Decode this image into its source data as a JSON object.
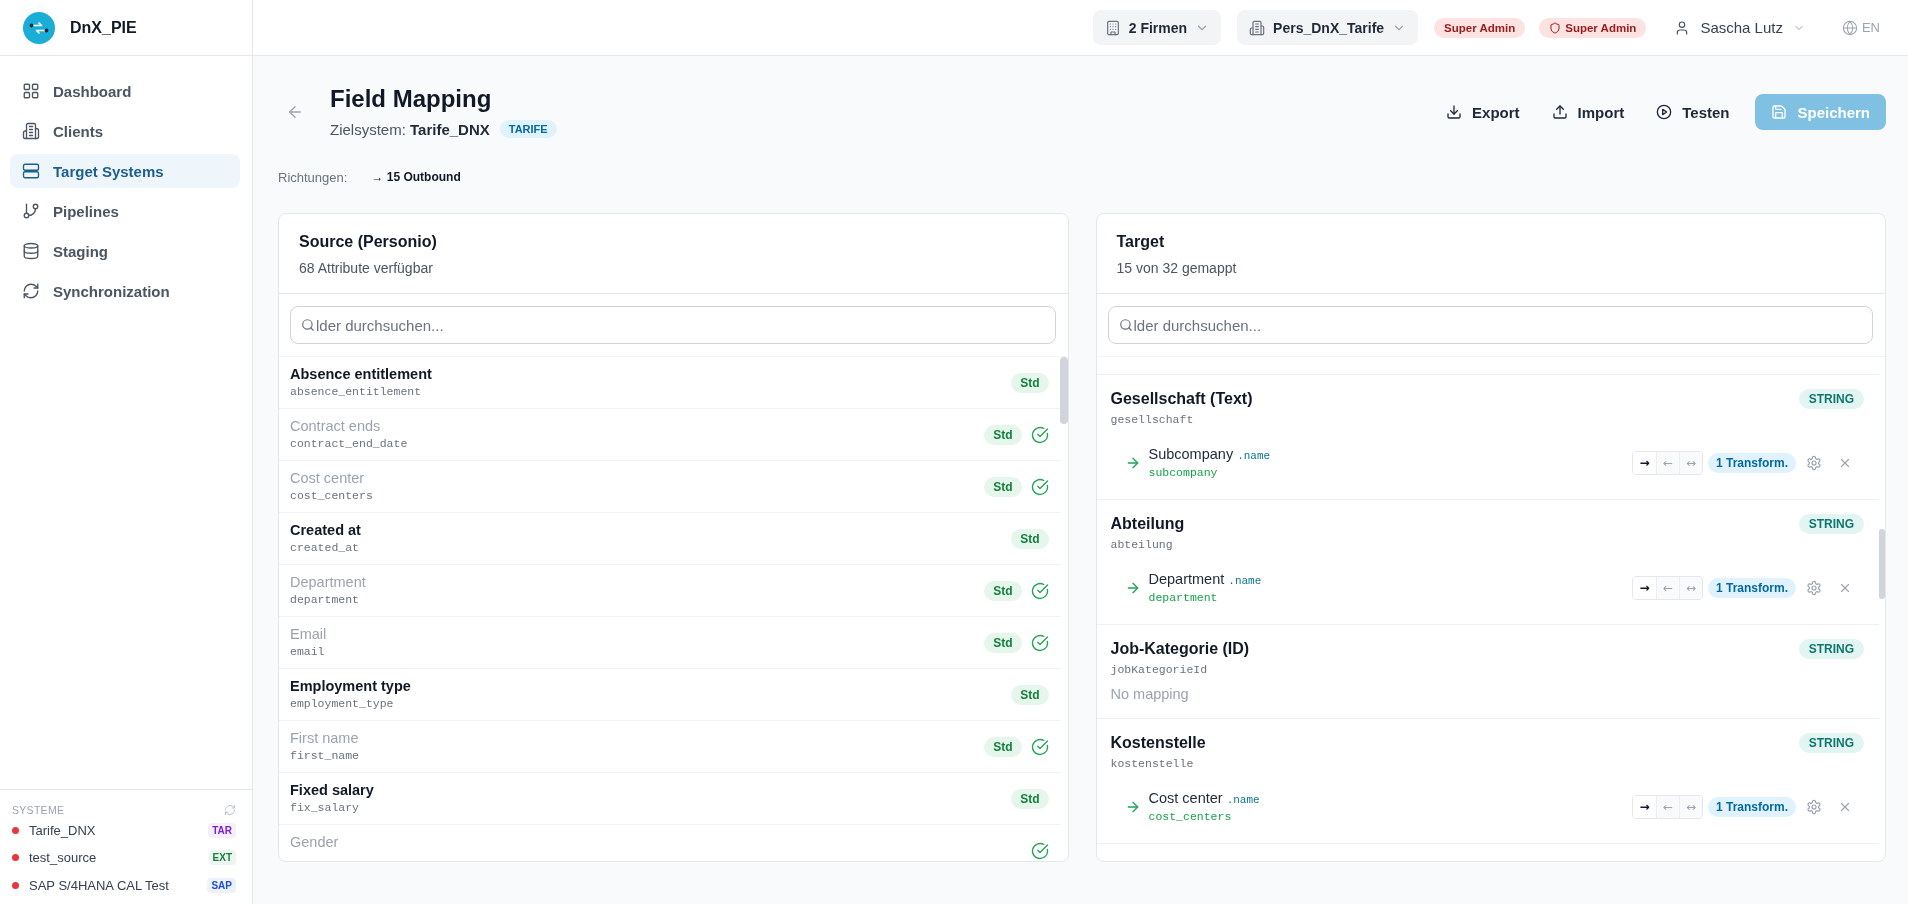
{
  "sidebar": {
    "brand": "DnX_PIE",
    "items": [
      {
        "label": "Dashboard",
        "selected": false
      },
      {
        "label": "Clients",
        "selected": false
      },
      {
        "label": "Target Systems",
        "selected": true
      },
      {
        "label": "Pipelines",
        "selected": false
      },
      {
        "label": "Staging",
        "selected": false
      },
      {
        "label": "Synchronization",
        "selected": false
      }
    ],
    "systems": {
      "title": "SYSTEME",
      "items": [
        {
          "name": "Tarife_DNX",
          "color": "#e5373d",
          "tag": {
            "label": "TAR",
            "color": "#7e22ce"
          }
        },
        {
          "name": "test_source",
          "color": "#e5373d",
          "tag": {
            "label": "EXT",
            "color": "#15803d"
          }
        },
        {
          "name": "SAP S/4HANA CAL Test",
          "color": "#e5373d",
          "tag": {
            "label": "SAP",
            "color": "#1d4ed8"
          }
        }
      ]
    }
  },
  "top_bar": {
    "company_picker": "2 Firmen",
    "tenant_picker": "Pers_DnX_Tarife",
    "roles": [
      {
        "label": "Super Admin",
        "kind": "plain"
      },
      {
        "label": "Super Admin",
        "kind": "shield"
      }
    ],
    "user": "Sascha Lutz",
    "language": "EN"
  },
  "header": {
    "title": "Field Mapping",
    "subtitle": "Zielsystem: **Tarife_DNX**",
    "system_tag": "TARIFE",
    "actions": [
      {
        "label": "Export",
        "kind": "ghost",
        "disabled": false
      },
      {
        "label": "Import",
        "kind": "ghost",
        "disabled": false
      },
      {
        "label": "Testen",
        "kind": "ghost",
        "disabled": false
      },
      {
        "label": "Speichern",
        "kind": "primary",
        "disabled": true
      }
    ],
    "directions_label": "Richtungen:",
    "directions_value": "→ 15 Outbound"
  },
  "source": {
    "title": "Source (Personio)",
    "subtitle": "68 Attribute verfügbar",
    "search": {
      "placeholder": "lder durchsuchen..."
    },
    "fields": [
      {
        "name": "Absence entitlement",
        "code": "absence_entitlement",
        "badge": "Std",
        "mapped": false
      },
      {
        "name": "Contract ends",
        "code": "contract_end_date",
        "badge": "Std",
        "mapped": true
      },
      {
        "name": "Cost center",
        "code": "cost_centers",
        "badge": "Std",
        "mapped": true
      },
      {
        "name": "Created at",
        "code": "created_at",
        "badge": "Std",
        "mapped": false
      },
      {
        "name": "Department",
        "code": "department",
        "badge": "Std",
        "mapped": true
      },
      {
        "name": "Email",
        "code": "email",
        "badge": "Std",
        "mapped": true
      },
      {
        "name": "Employment type",
        "code": "employment_type",
        "badge": "Std",
        "mapped": false
      },
      {
        "name": "First name",
        "code": "first_name",
        "badge": "Std",
        "mapped": true
      },
      {
        "name": "Fixed salary",
        "code": "fix_salary",
        "badge": "Std",
        "mapped": false
      },
      {
        "name": "Gender",
        "mapped": true
      }
    ]
  },
  "target": {
    "title": "Target",
    "subtitle": "15 von 32 gemappt",
    "search": {
      "placeholder": "lder durchsuchen..."
    },
    "items": [
      {
        "title": "Gesellschaft (Text)",
        "code": "gesellschaft",
        "type": "STRING",
        "mapping": {
          "field": "Subcompany",
          "path": ".name",
          "code": "subcompany",
          "directions": [
            {
              "symbol": "→",
              "selected": true
            },
            {
              "symbol": "←",
              "selected": false
            },
            {
              "symbol": "↔",
              "selected": false
            }
          ],
          "transform": "1 Transform."
        }
      },
      {
        "title": "Abteilung",
        "code": "abteilung",
        "type": "STRING",
        "mapping": {
          "field": "Department",
          "path": ".name",
          "code": "department",
          "directions": [
            {
              "symbol": "→",
              "selected": true
            },
            {
              "symbol": "←",
              "selected": false
            },
            {
              "symbol": "↔",
              "selected": false
            }
          ],
          "transform": "1 Transform."
        }
      },
      {
        "title": "Job-Kategorie (ID)",
        "code": "jobKategorieId",
        "type": "STRING",
        "note": "No mapping"
      },
      {
        "title": "Kostenstelle",
        "code": "kostenstelle",
        "type": "STRING",
        "mapping": {
          "field": "Cost center",
          "path": ".name",
          "code": "cost_centers",
          "directions": [
            {
              "symbol": "→",
              "selected": true
            },
            {
              "symbol": "←",
              "selected": false
            },
            {
              "symbol": "↔",
              "selected": false
            }
          ],
          "transform": "1 Transform."
        }
      }
    ]
  }
}
